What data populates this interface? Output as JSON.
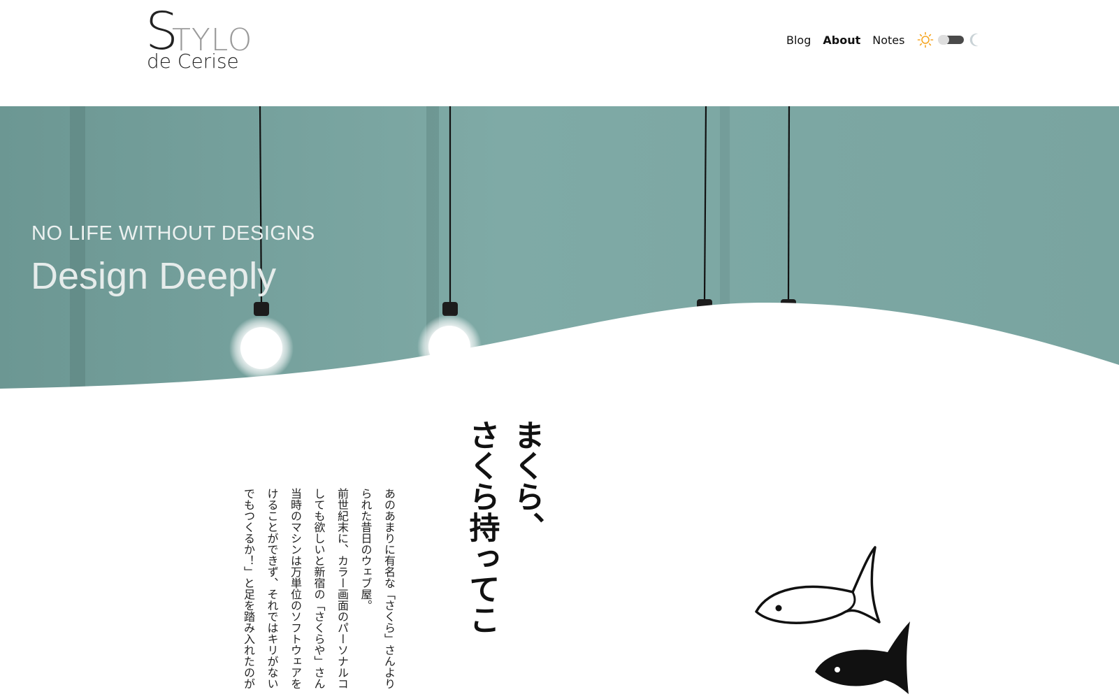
{
  "header": {
    "logo": {
      "s": "S",
      "tylo": "TYLO",
      "sub": "de Cerise"
    },
    "nav": [
      {
        "label": "Blog",
        "active": false
      },
      {
        "label": "About",
        "active": true
      },
      {
        "label": "Notes",
        "active": false
      }
    ],
    "theme_switch": {
      "light_icon": "sun-icon",
      "dark_icon": "moon-icon",
      "mode": "light"
    }
  },
  "hero": {
    "eyebrow": "NO LIFE WITHOUT DESIGNS",
    "title": "Design Deeply"
  },
  "article": {
    "heading_lines": [
      "まくら、",
      "さくら持ってこ"
    ],
    "body_lines": [
      "あのあまりに有名な「さくら」さんより",
      "られた昔日のウェブ屋。",
      "前世紀末に、カラー画面のパーソナルコ",
      "しても欲しいと新宿の「さくらや」さん",
      "当時のマシンは万単位のソフトウェアを",
      "けることができず、それではキリがない",
      "でもつくるか！」と足を踏み入れたのが"
    ]
  },
  "colors": {
    "hero_teal": "#7aa5a1",
    "sun_orange": "#f5a623",
    "moon_gray": "#c9d2d6"
  }
}
